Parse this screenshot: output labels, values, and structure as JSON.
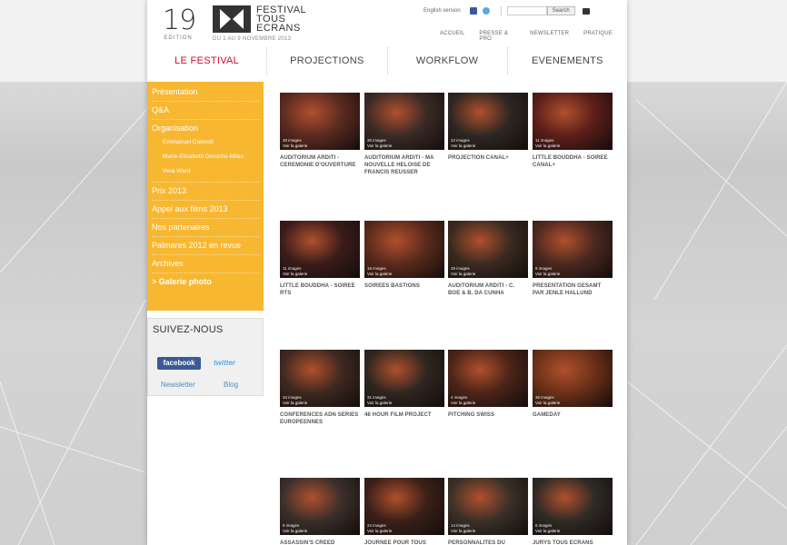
{
  "header": {
    "edition_number": "19",
    "edition_label": "EDITION",
    "logo_text": [
      "FESTIVAL",
      "TOUS",
      "ECRANS"
    ],
    "dates": "DU 1 AU 9 NOVEMBRE 2013",
    "english_version": "English version",
    "search_placeholder": "",
    "search_button": "Search",
    "subnav": [
      "ACCUEIL",
      "PRESSE & PRO",
      "NEWSLETTER",
      "PRATIQUE"
    ],
    "mainnav": [
      {
        "label": "LE FESTIVAL",
        "active": true
      },
      {
        "label": "PROJECTIONS",
        "active": false
      },
      {
        "label": "WORKFLOW",
        "active": false
      },
      {
        "label": "EVENEMENTS",
        "active": false
      }
    ]
  },
  "sidebar": {
    "items": [
      {
        "label": "Présentation"
      },
      {
        "label": "Q&A"
      },
      {
        "label": "Organisation"
      },
      {
        "label": "Emmanuel Cuénod",
        "sub": true
      },
      {
        "label": "Marie-Elisabeth Deroche-Miles",
        "sub": true
      },
      {
        "label": "Vera Ward",
        "sub": true
      },
      {
        "label": "Prix 2013"
      },
      {
        "label": "Appel aux films 2013"
      },
      {
        "label": "Nos partenaires"
      },
      {
        "label": "Palmares 2012 en revue"
      },
      {
        "label": "Archives"
      },
      {
        "label": "> Galerie photo"
      }
    ]
  },
  "follow": {
    "title": "SUIVEZ-NOUS",
    "facebook": "facebook",
    "twitter": "twitter",
    "newsletter": "Newsletter",
    "blog": "Blog"
  },
  "colors": {
    "accent_nav": "#c8102e",
    "sidebar_bg": "#f7b731",
    "facebook": "#3b5998",
    "twitter": "#55acee"
  },
  "gallery": [
    {
      "title": "AUDITORIUM ARDITI - CEREMONIE D'OUVERTURE",
      "count": "30 images",
      "voir": "Voir la galerie",
      "tone": "#5a2a20"
    },
    {
      "title": "AUDITORIUM ARDITI - MA NOUVELLE HELOISE DE FRANCIS REUSSER",
      "count": "30 images",
      "voir": "Voir la galerie",
      "tone": "#3a2a26"
    },
    {
      "title": "PROJECTION CANAL+",
      "count": "22 images",
      "voir": "Voir la galerie",
      "tone": "#2e2622"
    },
    {
      "title": "LITTLE BOUDDHA - SOIREE CANAL+",
      "count": "11 images",
      "voir": "Voir la galerie",
      "tone": "#5b1e1a"
    },
    {
      "title": "LITTLE BOUDDHA - SOIREE RTS",
      "count": "11 images",
      "voir": "Voir la galerie",
      "tone": "#3a1c1a"
    },
    {
      "title": "SOIREES BASTIONS",
      "count": "16 images",
      "voir": "Voir la galerie",
      "tone": "#5a2a1c"
    },
    {
      "title": "AUDITORIUM ARDITI - C. BOE & B. DA CUNHA",
      "count": "29 images",
      "voir": "Voir la galerie",
      "tone": "#3a2a20"
    },
    {
      "title": "PRESENTATION GESAMT PAR JENLE HALLUND",
      "count": "9 images",
      "voir": "Voir la galerie",
      "tone": "#4a2820"
    },
    {
      "title": "CONFERENCES ADN SERIES EUROPEENNES",
      "count": "34 images",
      "voir": "Voir la galerie",
      "tone": "#3e2820"
    },
    {
      "title": "48 HOUR FILM PROJECT",
      "count": "31 images",
      "voir": "Voir la galerie",
      "tone": "#2f2620"
    },
    {
      "title": "PITCHING SWISS",
      "count": "4 images",
      "voir": "Voir la galerie",
      "tone": "#4b2418"
    },
    {
      "title": "GAMEDAY",
      "count": "36 images",
      "voir": "Voir la galerie",
      "tone": "#6b3018"
    },
    {
      "title": "ASSASSIN'S CREED",
      "count": "8 images",
      "voir": "Voir la galerie",
      "tone": "#3a2e2a"
    },
    {
      "title": "JOURNEE POUR TOUS",
      "count": "24 images",
      "voir": "Voir la galerie",
      "tone": "#3a2018"
    },
    {
      "title": "PERSONNALITES DU",
      "count": "14 images",
      "voir": "Voir la galerie",
      "tone": "#3a3028"
    },
    {
      "title": "JURYS TOUS ECRANS",
      "count": "8 images",
      "voir": "Voir la galerie",
      "tone": "#2e2a26"
    }
  ]
}
